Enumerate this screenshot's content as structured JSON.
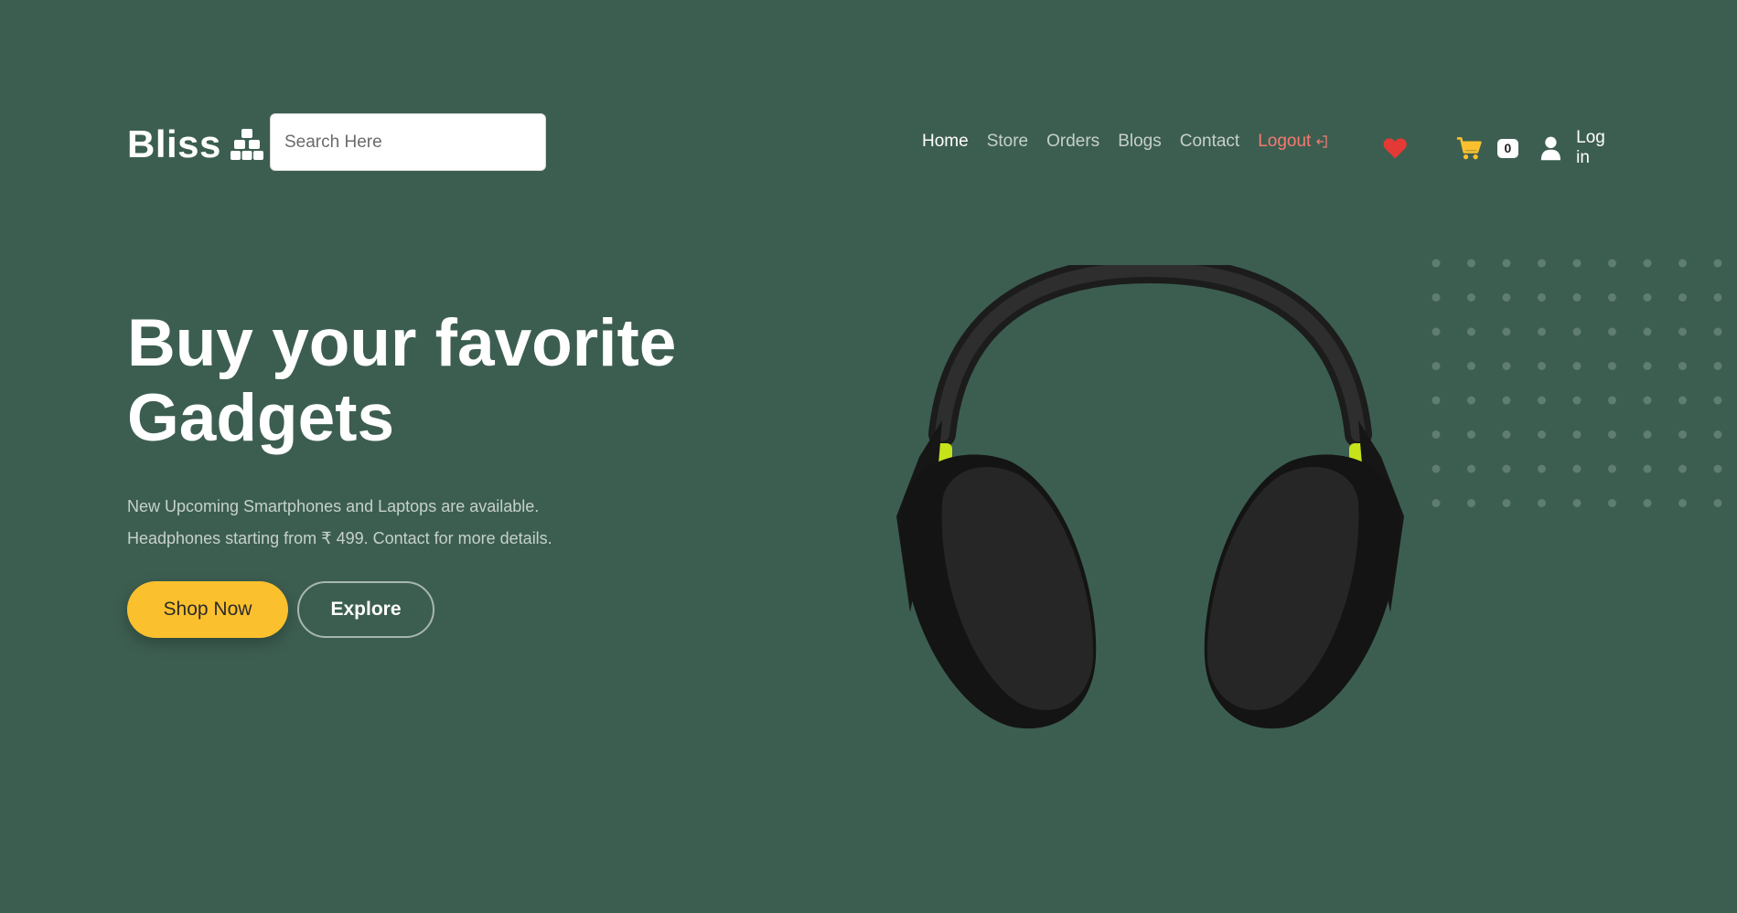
{
  "brand": {
    "name": "Bliss",
    "icon": "boxes-icon"
  },
  "search": {
    "placeholder": "Search Here"
  },
  "nav": {
    "items": [
      {
        "label": "Home",
        "active": true
      },
      {
        "label": "Store"
      },
      {
        "label": "Orders"
      },
      {
        "label": "Blogs"
      },
      {
        "label": "Contact"
      }
    ],
    "logout_label": "Logout",
    "logout_icon": "sign-out-icon"
  },
  "actions": {
    "wishlist_icon": "heart-icon",
    "cart_icon": "cart-icon",
    "cart_count": "0",
    "user_icon": "user-icon",
    "login_label": "Log in"
  },
  "hero": {
    "title_line1": "Buy your favorite",
    "title_line2": "Gadgets",
    "desc_line1": "New Upcoming Smartphones and Laptops are available.",
    "desc_line2": "Headphones starting from ₹ 499. Contact for more details.",
    "primary_button": "Shop Now",
    "secondary_button": "Explore",
    "image": "headphones-image"
  },
  "colors": {
    "background": "#3c5e50",
    "accent": "#fbc02d",
    "logout": "#f47b72",
    "heart": "#e53935"
  }
}
